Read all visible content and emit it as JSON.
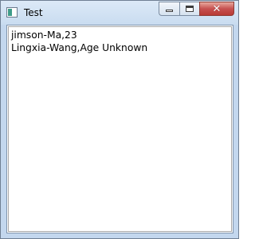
{
  "window": {
    "title": "Test",
    "icon": "app-window-icon",
    "caption_buttons": [
      "minimize-icon",
      "maximize-icon",
      "close-icon"
    ],
    "close_glyph": "✕"
  },
  "list": {
    "items": [
      "jimson-Ma,23",
      "Lingxia-Wang,Age Unknown"
    ]
  }
}
